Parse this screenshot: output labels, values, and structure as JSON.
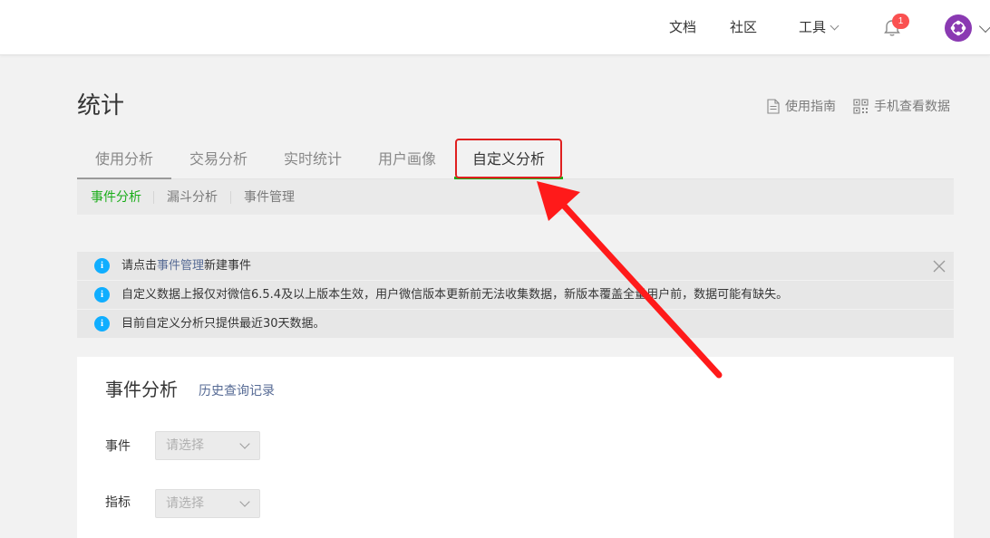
{
  "topnav": {
    "docs": "文档",
    "community": "社区",
    "tools": "工具",
    "notification_count": "1"
  },
  "page": {
    "title": "统计",
    "guide_link": "使用指南",
    "mobile_link": "手机查看数据"
  },
  "tabs": [
    "使用分析",
    "交易分析",
    "实时统计",
    "用户画像",
    "自定义分析"
  ],
  "subtabs": [
    "事件分析",
    "漏斗分析",
    "事件管理"
  ],
  "notices": {
    "n1_prefix": "请点击",
    "n1_link": "事件管理",
    "n1_suffix": "新建事件",
    "n2": "自定义数据上报仅对微信6.5.4及以上版本生效，用户微信版本更新前无法收集数据，新版本覆盖全量用户前，数据可能有缺失。",
    "n3": "目前自定义分析只提供最近30天数据。"
  },
  "card": {
    "title": "事件分析",
    "history_link": "历史查询记录",
    "event_label": "事件",
    "event_placeholder": "请选择",
    "metric_label": "指标",
    "metric_placeholder": "请选择"
  },
  "colors": {
    "accent_green": "#1aad19",
    "link_blue": "#576b95",
    "info_blue": "#10aeff",
    "badge_red": "#fa5151",
    "annotation_red": "#ff1a1a"
  }
}
